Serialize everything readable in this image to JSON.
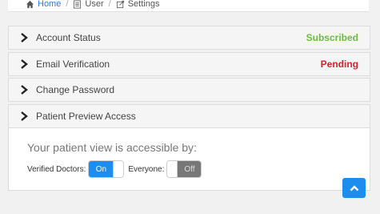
{
  "breadcrumb": {
    "home": "Home",
    "user": "User",
    "settings": "Settings"
  },
  "panels": [
    {
      "label": "Account Status",
      "status": "Subscribed",
      "status_color": "#6cbe3c"
    },
    {
      "label": "Email Verification",
      "status": "Pending",
      "status_color": "#d4242b"
    },
    {
      "label": "Change Password",
      "status": ""
    },
    {
      "label": "Patient Preview Access",
      "status": ""
    }
  ],
  "access": {
    "title": "Your patient view is accessible by:",
    "verified_label": "Verified Doctors:",
    "verified_value": "On",
    "everyone_label": "Everyone:",
    "everyone_value": "Off"
  },
  "colors": {
    "accent": "#1d8ef0",
    "link": "#2a7ad5"
  },
  "icons": {
    "home": "home-icon",
    "user": "list-icon",
    "settings": "settings-icon",
    "panel": "chevron-right-icon",
    "scroll": "chevron-up-icon"
  }
}
